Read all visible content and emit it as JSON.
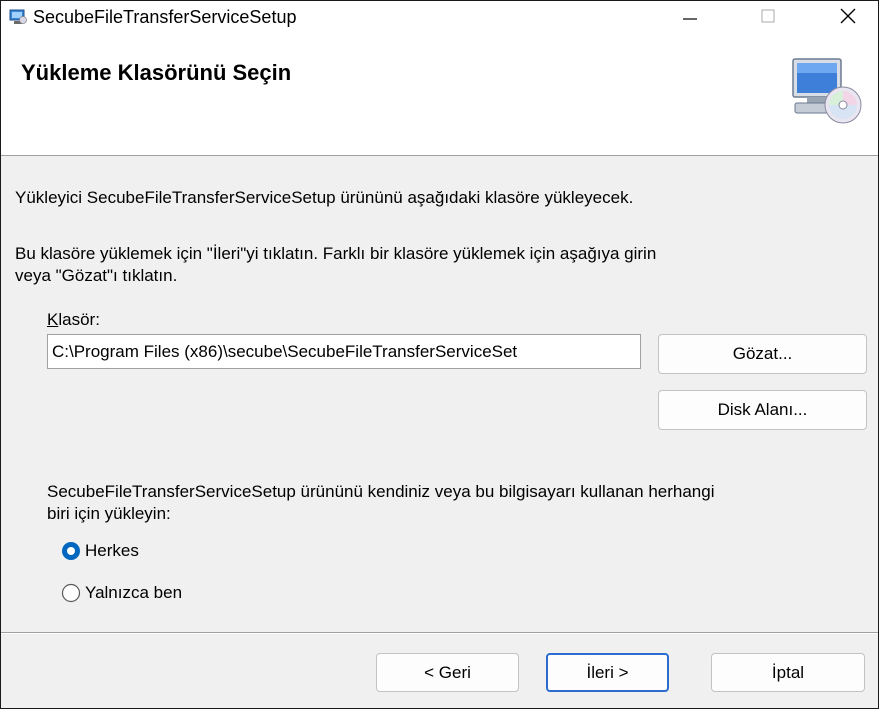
{
  "window": {
    "title": "SecubeFileTransferServiceSetup",
    "minimize_glyph": "—",
    "maximize_glyph": "☐",
    "close_glyph": "✕"
  },
  "banner": {
    "title": "Yükleme Klasörünü Seçin",
    "graphic": "computer-cd-icon"
  },
  "body": {
    "intro": "Yükleyici SecubeFileTransferServiceSetup ürününü aşağıdaki klasöre yükleyecek.",
    "instruction_line1": "Bu klasöre yüklemek için \"İleri\"yi tıklatın. Farklı bir klasöre yüklemek için aşağıya girin",
    "instruction_line2": "veya \"Gözat\"ı tıklatın.",
    "folder_label_first": "K",
    "folder_label_rest": "lasör:",
    "folder_value": "C:\\Program Files (x86)\\secube\\SecubeFileTransferServiceSet",
    "browse_button": "Gözat...",
    "disk_button": "Disk Alanı...",
    "install_for_line1": "SecubeFileTransferServiceSetup ürününü kendiniz veya bu bilgisayarı kullanan herhangi",
    "install_for_line2": "biri için yükleyin:",
    "radio_options": [
      {
        "label": "Herkes",
        "selected": true
      },
      {
        "label": "Yalnızca ben",
        "selected": false
      }
    ]
  },
  "footer": {
    "back": "< Geri",
    "next": "İleri >",
    "cancel": "İptal"
  },
  "colors": {
    "accent": "#0067c0",
    "focus_border": "#2c6cd0"
  }
}
